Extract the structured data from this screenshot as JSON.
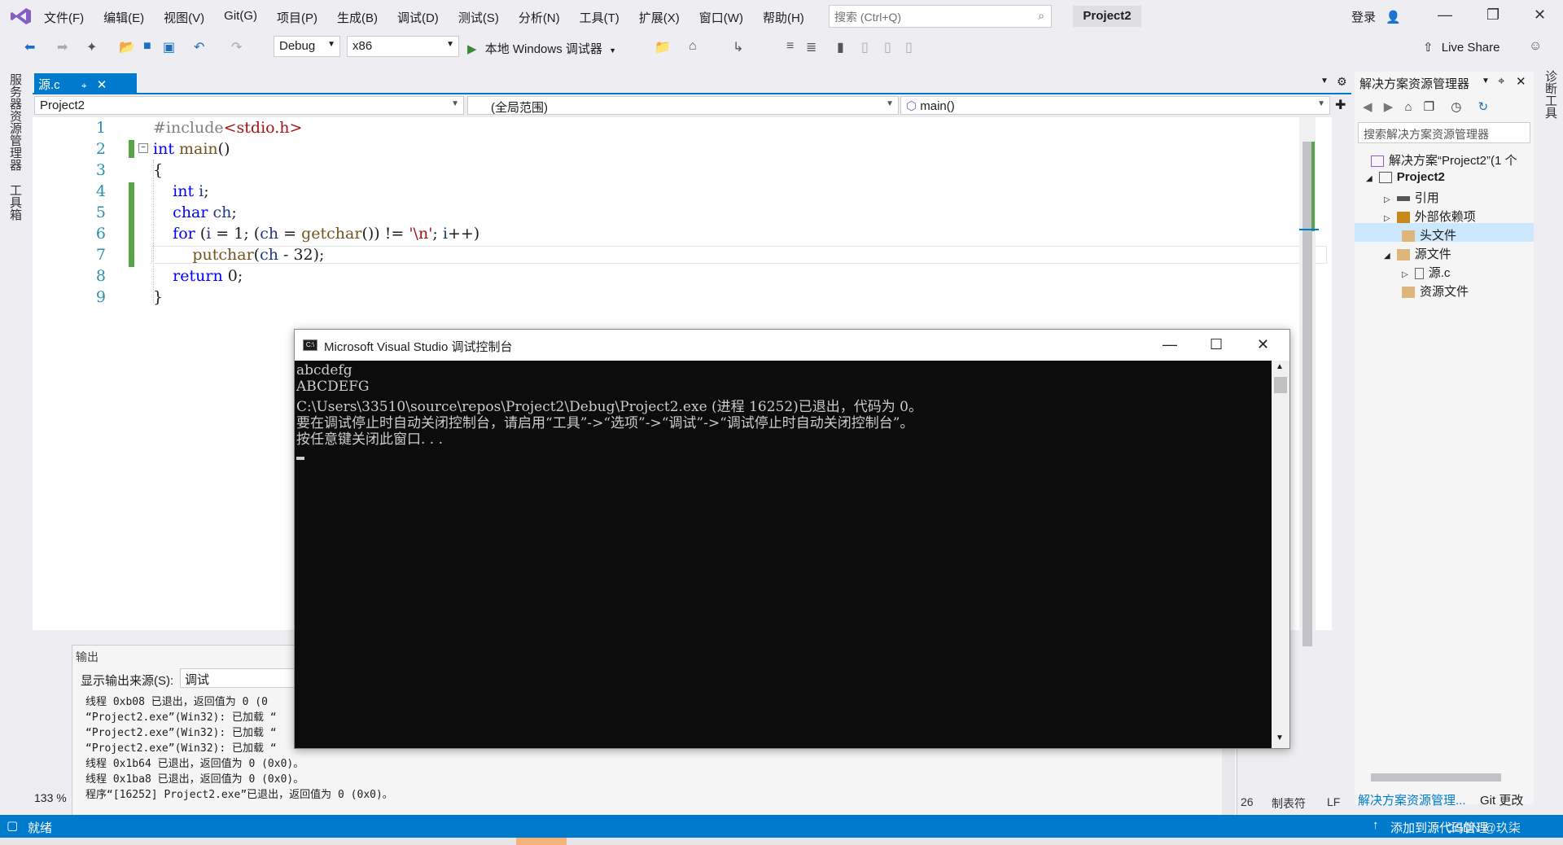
{
  "menubar": {
    "items": [
      "文件(F)",
      "编辑(E)",
      "视图(V)",
      "Git(G)",
      "项目(P)",
      "生成(B)",
      "调试(D)",
      "测试(S)",
      "分析(N)",
      "工具(T)",
      "扩展(X)",
      "窗口(W)",
      "帮助(H)"
    ],
    "search_placeholder": "搜索 (Ctrl+Q)",
    "project_name": "Project2",
    "login": "登录"
  },
  "toolbar": {
    "config": "Debug",
    "platform": "x86",
    "run_label": "本地 Windows 调试器",
    "live_share": "Live Share"
  },
  "leftside": {
    "server_explorer": "服务器资源管理器",
    "toolbox": "工具箱"
  },
  "rightside": {
    "diagnostics": "诊断工具"
  },
  "editor": {
    "tab_name": "源.c",
    "nav_project": "Project2",
    "nav_scope": "(全局范围)",
    "nav_member": "main()",
    "line_numbers": [
      "1",
      "2",
      "3",
      "4",
      "5",
      "6",
      "7",
      "8",
      "9"
    ],
    "zoom": "133 %"
  },
  "output": {
    "title": "输出",
    "source_label": "显示输出来源(S):",
    "source_value": "调试",
    "lines": [
      "线程 0xb08 已退出，返回值为 0 (0",
      "“Project2.exe”(Win32): 已加载 “",
      "“Project2.exe”(Win32): 已加载 “",
      "“Project2.exe”(Win32): 已加载 “",
      "线程 0x1b64 已退出，返回值为 0 (0x0)。",
      "线程 0x1ba8 已退出，返回值为 0 (0x0)。",
      "程序“[16252] Project2.exe”已退出，返回值为 0 (0x0)。"
    ]
  },
  "solution_explorer": {
    "title": "解决方案资源管理器",
    "search_placeholder": "搜索解决方案资源管理器",
    "solution": "解决方案“Project2”(1 个",
    "project": "Project2",
    "references": "引用",
    "external_deps": "外部依赖项",
    "header_files": "头文件",
    "source_files": "源文件",
    "source_file": "源.c",
    "resource_files": "资源文件",
    "footer_tab1": "解决方案资源管理...",
    "footer_tab2": "Git 更改"
  },
  "statusbar": {
    "ready": "就绪",
    "col": "26",
    "tab": "制表符",
    "eol": "LF",
    "add_source": "添加到源代码管理",
    "watermark": "CSDN @玖柒"
  },
  "console": {
    "title": "Microsoft Visual Studio 调试控制台",
    "lines": [
      "abcdefg",
      "ABCDEFG",
      "C:\\Users\\33510\\source\\repos\\Project2\\Debug\\Project2.exe (进程 16252)已退出，代码为 0。",
      "要在调试停止时自动关闭控制台，请启用“工具”->“选项”->“调试”->“调试停止时自动关闭控制台”。",
      "按任意键关闭此窗口. . ."
    ]
  },
  "colors": {
    "accent": "#007acc",
    "keyword": "#0000ff",
    "change_marker": "#57a64a"
  }
}
